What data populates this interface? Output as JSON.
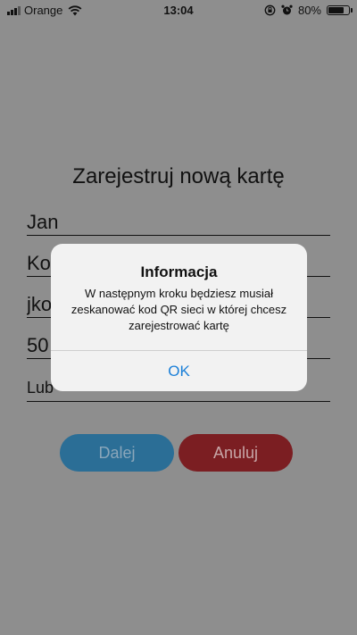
{
  "status_bar": {
    "carrier": "Orange",
    "time": "13:04",
    "battery": "80%",
    "battery_level": 0.8,
    "icons": [
      "signal-icon",
      "wifi-icon",
      "orientation-lock-icon",
      "alarm-icon",
      "battery-icon"
    ]
  },
  "form": {
    "title": "Zarejestruj nową kartę",
    "fields": [
      {
        "value": "Jan"
      },
      {
        "value": "Ko"
      },
      {
        "value": "jko"
      },
      {
        "value": "50"
      },
      {
        "value": "Lub"
      }
    ],
    "next_label": "Dalej",
    "cancel_label": "Anuluj"
  },
  "alert": {
    "title": "Informacja",
    "message": "W następnym kroku będziesz musiał zeskanować kod QR sieci w której chcesz zarejestrować kartę",
    "ok_label": "OK"
  },
  "colors": {
    "overlay": "#8e8e8e",
    "next_button": "#2b6e96",
    "cancel_button": "#7b1e22",
    "alert_action": "#1a7fd8"
  }
}
